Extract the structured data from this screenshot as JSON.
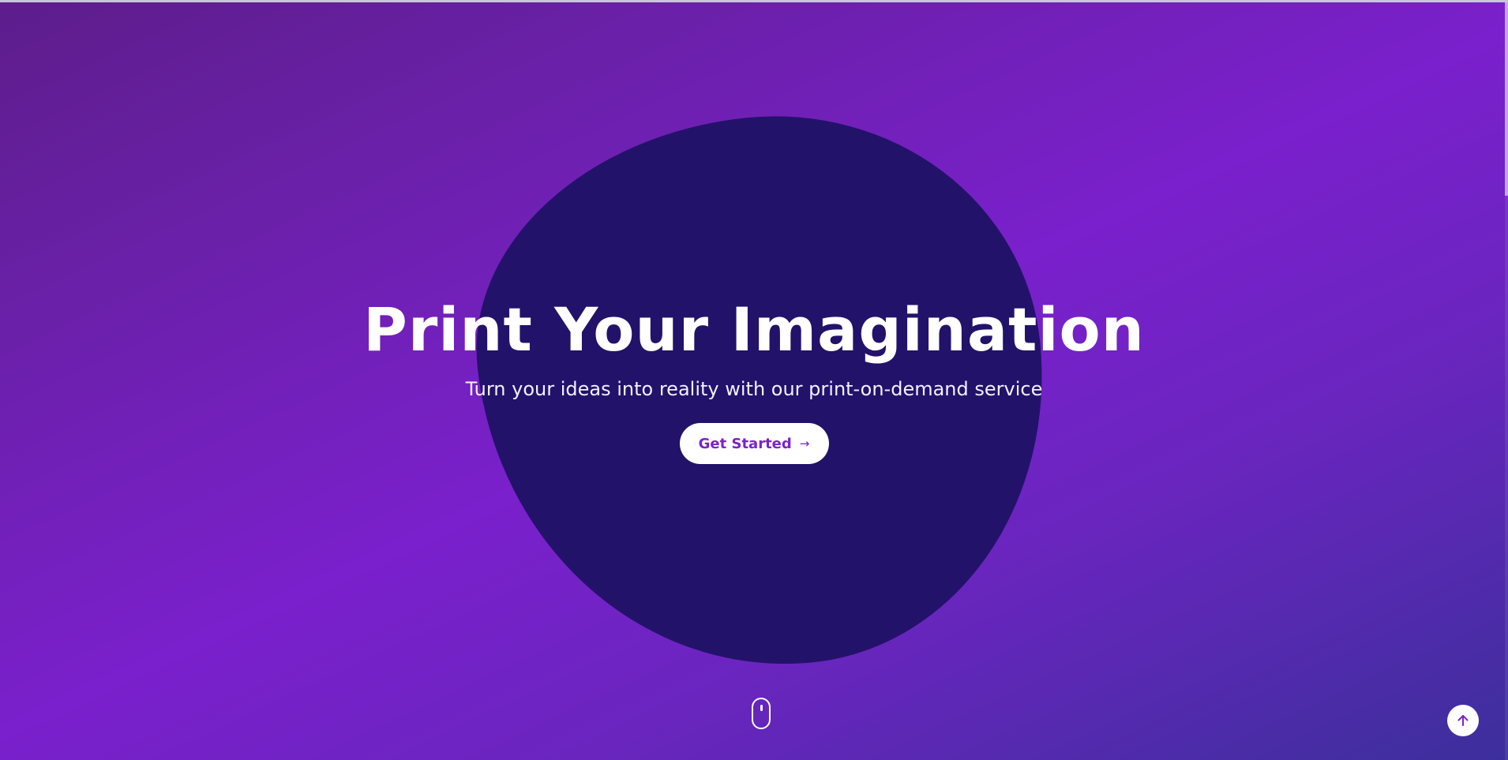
{
  "hero": {
    "title": "Print Your Imagination",
    "subtitle": "Turn your ideas into reality with our print-on-demand service",
    "cta_label": "Get Started",
    "cta_arrow": "→"
  },
  "icons": {
    "scroll_indicator": "mouse-icon",
    "back_to_top": "arrow-up-icon"
  },
  "colors": {
    "background_gradient_start": "#5d1d8b",
    "background_gradient_mid": "#7a20cc",
    "background_gradient_end": "#3c2f9c",
    "blob": "#23126a",
    "accent": "#7b22cc",
    "text": "#ffffff"
  }
}
